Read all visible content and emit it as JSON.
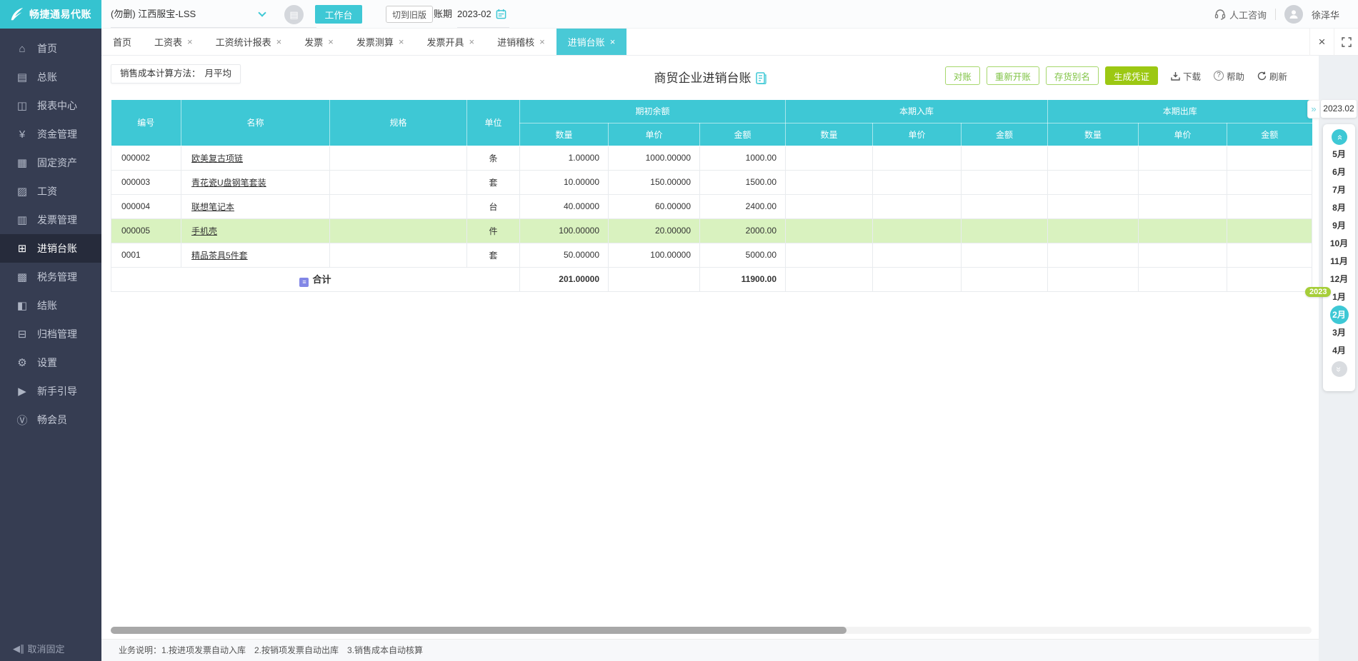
{
  "topbar": {
    "logo_text": "畅捷通易代账",
    "company": "(勿删) 江西服宝-LSS",
    "workbench_button": "工作台",
    "switch_old_button": "切到旧版",
    "period_label": "账期",
    "period_value": "2023-02",
    "support_label": "人工咨询",
    "username": "徐泽华",
    "badge_glyph": "▤"
  },
  "tabs": {
    "close_all_glyph": "×",
    "items": [
      {
        "label": "首页",
        "close": "",
        "state": ""
      },
      {
        "label": "工资表",
        "close": "×",
        "state": ""
      },
      {
        "label": "工资统计报表",
        "close": "×",
        "state": ""
      },
      {
        "label": "发票",
        "close": "×",
        "state": ""
      },
      {
        "label": "发票测算",
        "close": "×",
        "state": ""
      },
      {
        "label": "发票开具",
        "close": "×",
        "state": ""
      },
      {
        "label": "进销稽核",
        "close": "×",
        "state": ""
      },
      {
        "label": "进销台账",
        "close": "×",
        "state": "active"
      }
    ]
  },
  "sidebar": {
    "unpin_label": "取消固定",
    "unpin_glyph": "◀∥",
    "items": [
      {
        "icon": "⌂",
        "label": "首页",
        "state": ""
      },
      {
        "icon": "▤",
        "label": "总账",
        "state": ""
      },
      {
        "icon": "◫",
        "label": "报表中心",
        "state": ""
      },
      {
        "icon": "¥",
        "label": "资金管理",
        "state": ""
      },
      {
        "icon": "▦",
        "label": "固定资产",
        "state": ""
      },
      {
        "icon": "▨",
        "label": "工资",
        "state": ""
      },
      {
        "icon": "▥",
        "label": "发票管理",
        "state": ""
      },
      {
        "icon": "⊞",
        "label": "进销台账",
        "state": "active"
      },
      {
        "icon": "▩",
        "label": "税务管理",
        "state": ""
      },
      {
        "icon": "◧",
        "label": "结账",
        "state": ""
      },
      {
        "icon": "⊟",
        "label": "归档管理",
        "state": ""
      },
      {
        "icon": "⚙",
        "label": "设置",
        "state": ""
      },
      {
        "icon": "▶",
        "label": "新手引导",
        "state": ""
      },
      {
        "icon": "Ⓥ",
        "label": "畅会员",
        "state": ""
      }
    ]
  },
  "toolbar": {
    "cost_method_label": "销售成本计算方法：",
    "cost_method_value": "月平均",
    "title": "商贸企业进销台账",
    "reconcile_button": "对账",
    "reopen_button": "重新开账",
    "alias_button": "存货别名",
    "voucher_button": "生成凭证",
    "download_label": "下载",
    "help_label": "帮助",
    "help_glyph": "?",
    "refresh_label": "刷新"
  },
  "table": {
    "header": {
      "code": "编号",
      "name": "名称",
      "spec": "规格",
      "unit": "单位",
      "opening": "期初余额",
      "inbound": "本期入库",
      "outbound": "本期出库",
      "qty": "数量",
      "price": "单价",
      "amount": "金额"
    },
    "rows": [
      {
        "code": "000002",
        "name": "欧美复古项链",
        "spec": "",
        "unit": "条",
        "qty": "1.00000",
        "price": "1000.00000",
        "amount": "1000.00",
        "state": ""
      },
      {
        "code": "000003",
        "name": "青花瓷U盘钢笔套装",
        "spec": "",
        "unit": "套",
        "qty": "10.00000",
        "price": "150.00000",
        "amount": "1500.00",
        "state": ""
      },
      {
        "code": "000004",
        "name": "联想笔记本",
        "spec": "",
        "unit": "台",
        "qty": "40.00000",
        "price": "60.00000",
        "amount": "2400.00",
        "state": ""
      },
      {
        "code": "000005",
        "name": "手机壳",
        "spec": "",
        "unit": "件",
        "qty": "100.00000",
        "price": "20.00000",
        "amount": "2000.00",
        "state": "highlight"
      },
      {
        "code": "0001",
        "name": "精品茶具5件套",
        "spec": "",
        "unit": "套",
        "qty": "50.00000",
        "price": "100.00000",
        "amount": "5000.00",
        "state": ""
      }
    ],
    "total": {
      "label": "合计",
      "icon_glyph": "≡",
      "qty": "201.00000",
      "amount": "11900.00"
    }
  },
  "calendar": {
    "period": "2023.02",
    "year_badge": "2023",
    "handle_glyph": "»",
    "arrow_glyph": "»",
    "months": [
      {
        "label": "5月",
        "state": ""
      },
      {
        "label": "6月",
        "state": ""
      },
      {
        "label": "7月",
        "state": ""
      },
      {
        "label": "8月",
        "state": ""
      },
      {
        "label": "9月",
        "state": ""
      },
      {
        "label": "10月",
        "state": ""
      },
      {
        "label": "11月",
        "state": ""
      },
      {
        "label": "12月",
        "state": ""
      },
      {
        "label": "1月",
        "state": ""
      },
      {
        "label": "2月",
        "state": "active"
      },
      {
        "label": "3月",
        "state": ""
      },
      {
        "label": "4月",
        "state": ""
      }
    ]
  },
  "footer": {
    "note": "业务说明：1.按进项发票自动入库　2.按销项发票自动出库　3.销售成本自动核算"
  },
  "colors": {
    "accent_teal": "#3EC8D5",
    "accent_green_solid": "#9CC813",
    "accent_green_outline": "#7FC344",
    "sidebar_bg": "#363D52",
    "highlight_row": "#D9F2BF",
    "total_row_bg": "#EAF6FD",
    "badge_green": "#A6CE39"
  }
}
